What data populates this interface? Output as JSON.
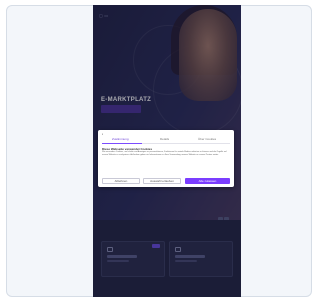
{
  "hero": {
    "title": "E-MARKTPLATZ"
  },
  "cookie_dialog": {
    "tabs": [
      "Zustimmung",
      "Details",
      "Über Cookies"
    ],
    "heading": "Diese Webseite verwendet Cookies",
    "body": "Wir verwenden Cookies, um Inhalte und Anzeigen zu personalisieren, Funktionen für soziale Medien anbieten zu können und die Zugriffe auf unsere Website zu analysieren. Außerdem geben wir Informationen zu Ihrer Verwendung unserer Website an unsere Partner weiter.",
    "buttons": {
      "deny": "Ablehnen",
      "select": "Auswahl erlauben",
      "allow_all": "Alle zulassen"
    }
  },
  "colors": {
    "accent": "#7b3dff",
    "background": "#1f2140"
  }
}
